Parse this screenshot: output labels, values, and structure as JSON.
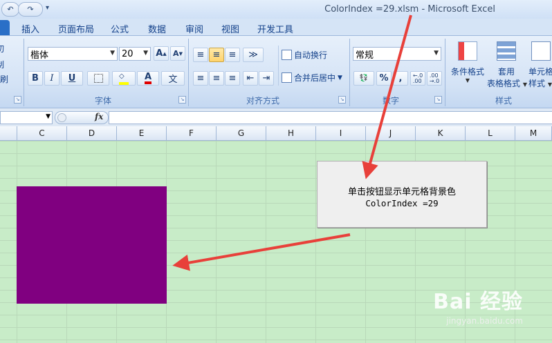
{
  "window": {
    "title": "ColorIndex =29.xlsm  -  Microsoft Excel"
  },
  "qat": {
    "undo": "↶",
    "redo": "↷",
    "customize": "▾"
  },
  "tabs": [
    "插入",
    "页面布局",
    "公式",
    "数据",
    "审阅",
    "视图",
    "开发工具"
  ],
  "ribbon": {
    "clipboard": {
      "cut": "剪切",
      "copy": "复制",
      "format_painter": "格式刷"
    },
    "font": {
      "name": "楷体",
      "size": "20",
      "grow": "A",
      "shrink": "A",
      "bold": "B",
      "italic": "I",
      "underline": "U",
      "font_color": "A",
      "phonetic": "文",
      "label": "字体"
    },
    "alignment": {
      "wrap_text": "自动换行",
      "merge_center": "合并后居中",
      "label": "对齐方式"
    },
    "number": {
      "format": "常规",
      "percent": "%",
      "comma": ",",
      "inc_decimal": "←.0\n.00",
      "dec_decimal": ".00\n→.0",
      "label": "数字"
    },
    "styles": {
      "conditional_format": "条件格式",
      "table_format_line1": "套用",
      "table_format_line2": "表格格式",
      "cell_styles_line1": "单元格",
      "cell_styles_line2": "样式",
      "label": "样式"
    }
  },
  "formula_bar": {
    "fx": "fx"
  },
  "columns": [
    "C",
    "D",
    "E",
    "F",
    "G",
    "H",
    "I",
    "J",
    "K",
    "L",
    "M"
  ],
  "colors": {
    "cell_fill": "#800080",
    "sheet_bg": "#c8ecc8",
    "arrow": "#e8403a"
  },
  "shape_button": {
    "line1": "单击按钮显示单元格背景色",
    "line2": "ColorIndex =29"
  },
  "watermark": {
    "logo": "Bai 经验",
    "url": "jingyan.baidu.com"
  }
}
